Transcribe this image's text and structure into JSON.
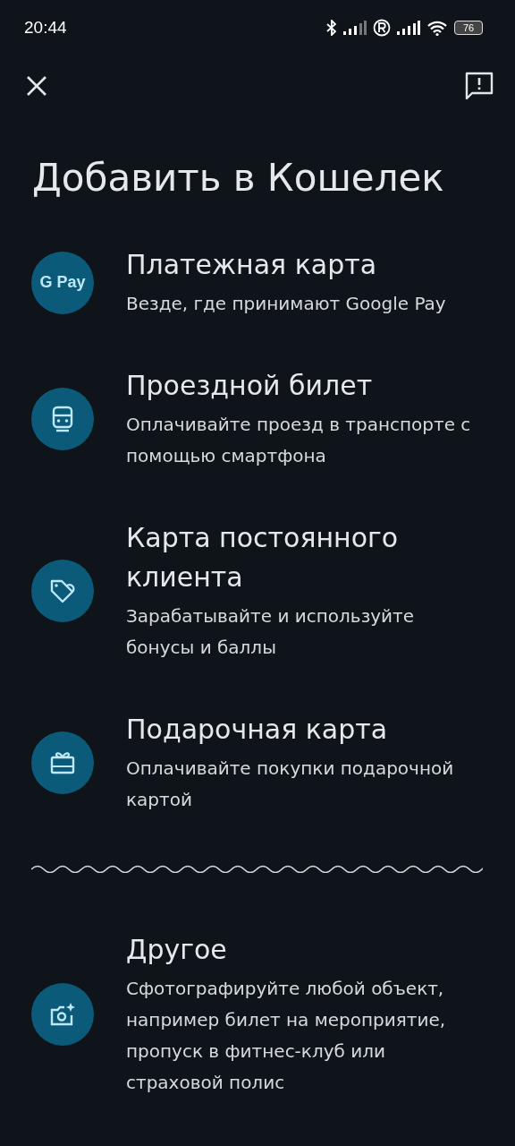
{
  "status_bar": {
    "time": "20:44",
    "battery": "76"
  },
  "title": "Добавить в Кошелек",
  "options": [
    {
      "kind": "gpay",
      "logo_text": "G Pay",
      "title": "Платежная карта",
      "subtitle": "Везде, где принимают Google Pay"
    },
    {
      "kind": "transit",
      "title": "Проездной билет",
      "subtitle": "Оплачивайте проезд в транспорте с помощью смартфона"
    },
    {
      "kind": "loyalty",
      "title": "Карта постоянного клиента",
      "subtitle": "Зарабатывайте и используйте бонусы и баллы"
    },
    {
      "kind": "gift",
      "title": "Подарочная карта",
      "subtitle": "Оплачивайте покупки подарочной картой"
    },
    {
      "kind": "divider"
    },
    {
      "kind": "photo",
      "title": "Другое",
      "subtitle": "Сфотографируйте любой объект, например билет на мероприятие, пропуск в фитнес-клуб или страховой полис"
    }
  ]
}
